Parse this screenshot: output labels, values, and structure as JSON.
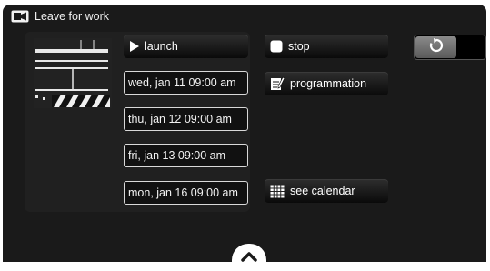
{
  "title": {
    "text": "Leave for work",
    "icon": "scene-icon"
  },
  "scene_image": {
    "icon": "clapperboard-icon"
  },
  "buttons": {
    "launch": {
      "label": "launch",
      "icon": "play-icon"
    },
    "stop": {
      "label": "stop",
      "icon": "stop-icon"
    },
    "programmation": {
      "label": "programmation",
      "icon": "edit-icon"
    },
    "see_calendar": {
      "label": "see calendar",
      "icon": "calendar-icon"
    }
  },
  "schedule": [
    {
      "label": "wed, jan 11 09:00 am"
    },
    {
      "label": "thu, jan 12 09:00 am"
    },
    {
      "label": "fri, jan 13 09:00 am"
    },
    {
      "label": "mon, jan 16 09:00 am"
    }
  ],
  "refresh_toggle": {
    "icon": "refresh-icon"
  },
  "navigation": {
    "scroll_icon": "chevron-up-icon"
  },
  "colors": {
    "panel_bg": "#1a1a1a",
    "button_top": "#2e2e2e",
    "button_bottom": "#0a0a0a",
    "text": "#ffffff"
  }
}
